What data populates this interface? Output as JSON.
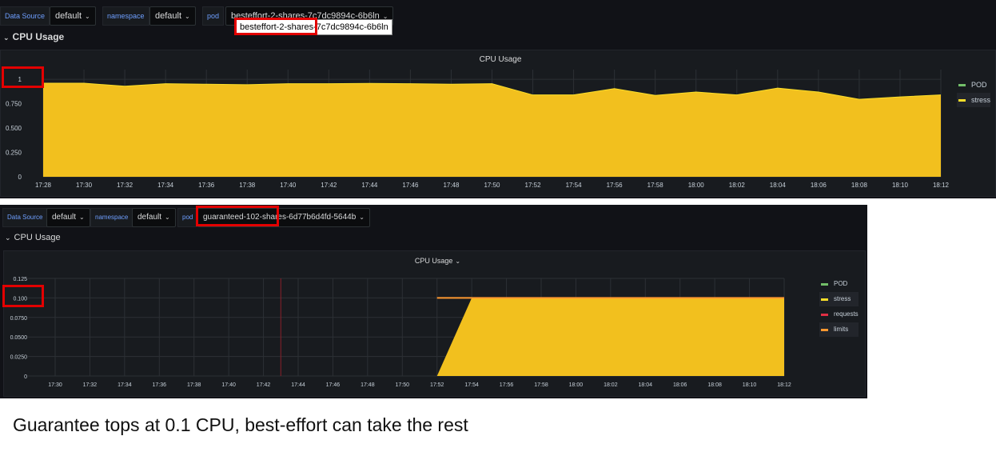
{
  "panel1": {
    "vars": {
      "datasource_label": "Data Source",
      "datasource_value": "default",
      "namespace_label": "namespace",
      "namespace_value": "default",
      "pod_label": "pod",
      "pod_value": "besteffort-2-shares-7c7dc9894c-6b6ln"
    },
    "tooltip": "besteffort-2-shares-7c7dc9894c-6b6ln",
    "row_title": "CPU Usage",
    "graph_title": "CPU Usage",
    "legend": [
      {
        "name": "POD",
        "color": "#73bf69"
      },
      {
        "name": "stress",
        "color": "#fade2a"
      }
    ]
  },
  "panel2": {
    "vars": {
      "datasource_label": "Data Source",
      "datasource_value": "default",
      "namespace_label": "namespace",
      "namespace_value": "default",
      "pod_label": "pod",
      "pod_value": "guaranteed-102-shares-6d77b6d4fd-5644b"
    },
    "row_title": "CPU Usage",
    "graph_title": "CPU Usage",
    "legend": [
      {
        "name": "POD",
        "color": "#73bf69"
      },
      {
        "name": "stress",
        "color": "#fade2a"
      },
      {
        "name": "requests",
        "color": "#e02f44"
      },
      {
        "name": "limits",
        "color": "#ff9830"
      }
    ]
  },
  "caption": "Guarantee tops at 0.1 CPU, best-effort can take the rest",
  "chart_data": [
    {
      "type": "area",
      "title": "CPU Usage",
      "x": [
        "17:28",
        "17:30",
        "17:32",
        "17:34",
        "17:36",
        "17:38",
        "17:40",
        "17:42",
        "17:44",
        "17:46",
        "17:48",
        "17:50",
        "17:52",
        "17:54",
        "17:56",
        "17:58",
        "18:00",
        "18:02",
        "18:04",
        "18:06",
        "18:08",
        "18:10",
        "18:12"
      ],
      "y_ticks": [
        "0",
        "0.250",
        "0.500",
        "0.750",
        "1"
      ],
      "ylim": [
        0,
        1.1
      ],
      "series": [
        {
          "name": "stress",
          "color": "#f2c01e",
          "values": [
            0.96,
            0.96,
            0.93,
            0.955,
            0.95,
            0.945,
            0.955,
            0.955,
            0.958,
            0.955,
            0.95,
            0.955,
            0.84,
            0.84,
            0.905,
            0.835,
            0.87,
            0.84,
            0.91,
            0.87,
            0.795,
            0.82,
            0.84
          ]
        }
      ],
      "legend_position": "right",
      "grid": true
    },
    {
      "type": "area",
      "title": "CPU Usage",
      "x": [
        "17:30",
        "17:32",
        "17:34",
        "17:36",
        "17:38",
        "17:40",
        "17:42",
        "17:44",
        "17:46",
        "17:48",
        "17:50",
        "17:52",
        "17:54",
        "17:56",
        "17:58",
        "18:00",
        "18:02",
        "18:04",
        "18:06",
        "18:08",
        "18:10",
        "18:12"
      ],
      "y_ticks": [
        "0",
        "0.0250",
        "0.0500",
        "0.0750",
        "0.100",
        "0.125"
      ],
      "ylim": [
        0,
        0.125
      ],
      "series": [
        {
          "name": "stress",
          "color": "#f2c01e",
          "points": [
            [
              "17:52",
              0
            ],
            [
              "17:54",
              0.1
            ],
            [
              "18:12",
              0.1
            ]
          ]
        },
        {
          "name": "limits",
          "color": "#ff9830",
          "points": [
            [
              "17:52",
              0.1
            ],
            [
              "18:12",
              0.1
            ]
          ]
        }
      ],
      "legend_position": "right",
      "grid": true
    }
  ]
}
